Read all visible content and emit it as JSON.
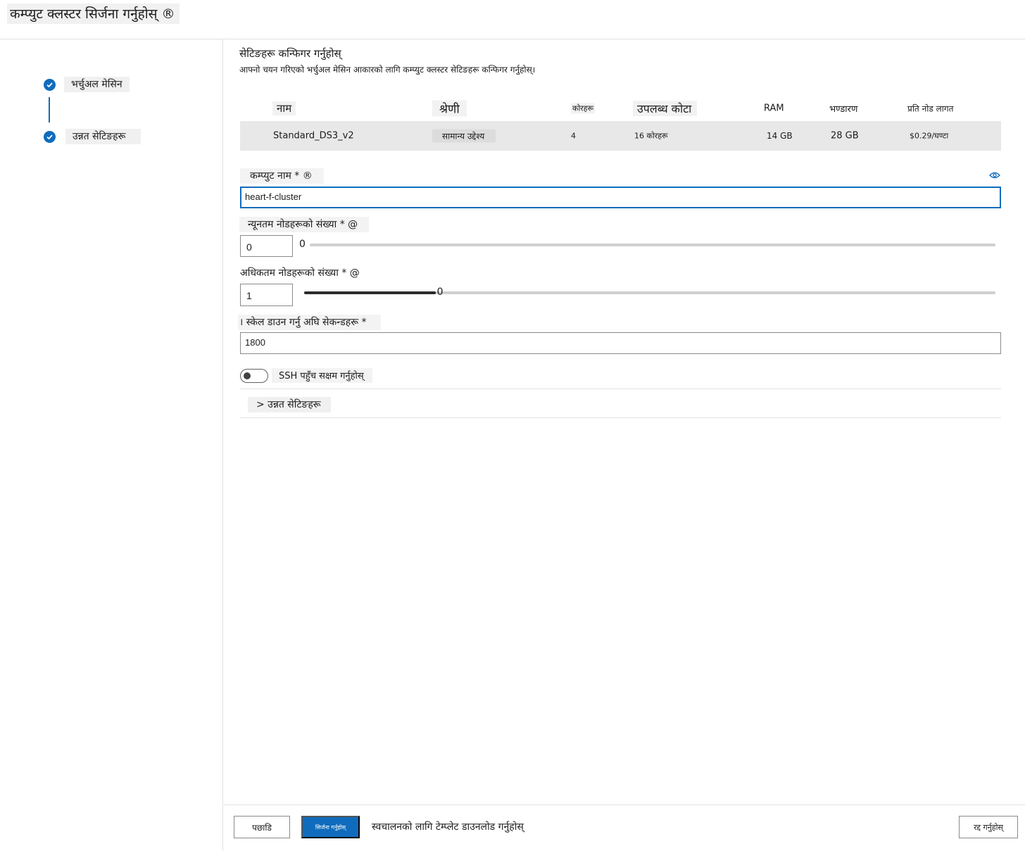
{
  "header": {
    "title": "कम्प्युट क्लस्टर सिर्जना गर्नुहोस् ®"
  },
  "steps": [
    {
      "label": "भर्चुअल मेसिन",
      "status": "complete"
    },
    {
      "label": "उन्नत सेटिङहरू",
      "status": "complete"
    }
  ],
  "main": {
    "section_title": "सेटिङहरू कन्फिगर गर्नुहोस्",
    "section_description": "आफ्नो चयन गरिएको भर्चुअल मेसिन आकारको लागि कम्प्युट क्लस्टर सेटिङहरू कन्फिगर गर्नुहोस्।",
    "vm_table": {
      "headers": {
        "name": "नाम",
        "category": "श्रेणी",
        "cores": "कोरहरू",
        "quota": "उपलब्ध कोटा",
        "ram": "RAM",
        "storage": "भण्डारण",
        "cost": "प्रति नोड लागत"
      },
      "row": {
        "name": "Standard_DS3_v2",
        "category": "सामान्य उद्देश्य",
        "cores": "4",
        "quota": "16 कोरहरू",
        "ram": "14 GB",
        "storage": "28 GB",
        "cost": "$0.29/घण्टा"
      }
    },
    "compute_name": {
      "label": "कम्प्युट नाम * ®",
      "value": "heart-f-cluster"
    },
    "min_nodes": {
      "label": "न्यूनतम नोडहरूको संख्या * @",
      "value": "0",
      "slider_value": "0",
      "slider_fraction": 0
    },
    "max_nodes": {
      "label": "अधिकतम नोडहरूको संख्या * @",
      "value": "1",
      "slider_value": "0",
      "slider_fraction": 0.19
    },
    "scale_down": {
      "label": "।   स्केल डाउन गर्नु अघि सेकन्डहरू *",
      "value": "1800"
    },
    "ssh": {
      "label": "SSH पहुँच सक्षम गर्नुहोस्",
      "enabled": false
    },
    "advanced_toggle": "> उन्नत सेटिङहरू"
  },
  "footer": {
    "back_label": "पछाडि",
    "create_label": "सिर्जना गर्नुहोस्",
    "template_link": "स्वचालनको लागि टेम्प्लेट डाउनलोड गर्नुहोस्",
    "cancel_label": "रद्द गर्नुहोस्"
  },
  "colors": {
    "accent": "#0f6cbd",
    "row_bg": "#e8e8e8",
    "border": "#8a8a8a"
  },
  "icons": {
    "step_check": "checkmark-circle-icon",
    "visibility": "eye-icon"
  }
}
